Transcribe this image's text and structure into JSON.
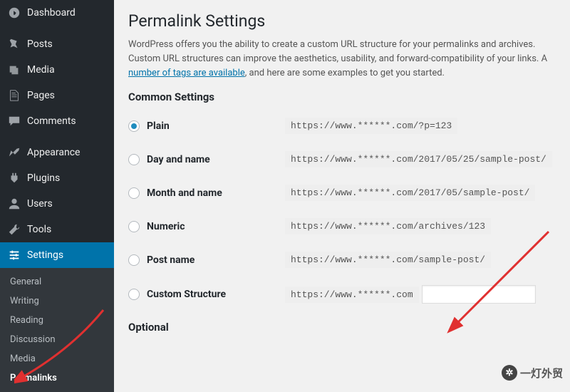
{
  "sidebar": {
    "items": [
      {
        "label": "Dashboard"
      },
      {
        "label": "Posts"
      },
      {
        "label": "Media"
      },
      {
        "label": "Pages"
      },
      {
        "label": "Comments"
      },
      {
        "label": "Appearance"
      },
      {
        "label": "Plugins"
      },
      {
        "label": "Users"
      },
      {
        "label": "Tools"
      },
      {
        "label": "Settings"
      }
    ],
    "submenu": [
      {
        "label": "General"
      },
      {
        "label": "Writing"
      },
      {
        "label": "Reading"
      },
      {
        "label": "Discussion"
      },
      {
        "label": "Media"
      },
      {
        "label": "Permalinks"
      }
    ]
  },
  "page": {
    "title": "Permalink Settings",
    "desc_prefix": "WordPress offers you the ability to create a custom URL structure for your permalinks and archives. Custom URL structures can improve the aesthetics, usability, and forward-compatibility of your links. A ",
    "desc_link": "number of tags are available",
    "desc_suffix": ", and here are some examples to get you started.",
    "section_common": "Common Settings",
    "section_optional": "Optional"
  },
  "options": [
    {
      "label": "Plain",
      "url": "https://www.******.com/?p=123"
    },
    {
      "label": "Day and name",
      "url": "https://www.******.com/2017/05/25/sample-post/"
    },
    {
      "label": "Month and name",
      "url": "https://www.******.com/2017/05/sample-post/"
    },
    {
      "label": "Numeric",
      "url": "https://www.******.com/archives/123"
    },
    {
      "label": "Post name",
      "url": "https://www.******.com/sample-post/"
    },
    {
      "label": "Custom Structure",
      "url": "https://www.******.com"
    }
  ],
  "watermark": {
    "text": "一灯外贸"
  }
}
